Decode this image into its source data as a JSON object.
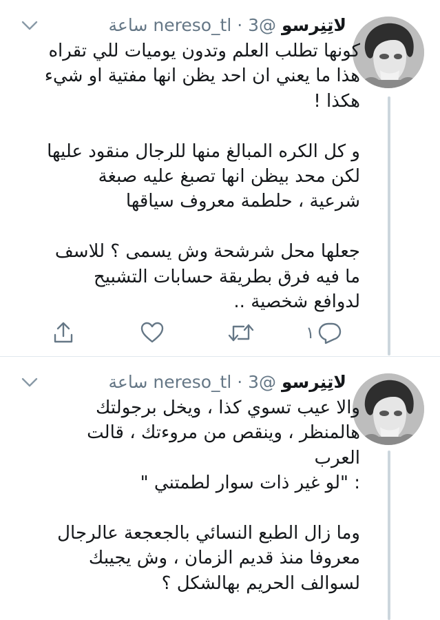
{
  "tweets": [
    {
      "author_name": "لاتِنِرسو",
      "handle": "@nereso_tl",
      "separator": " · ",
      "time": "3 ساعة",
      "avatar_icon": "avatar-photo-icon",
      "menu_icon": "chevron-down-icon",
      "lines": [
        "كونها تطلب العلم وتدون يوميات للي تقراه",
        "هذا ما يعني ان احد يظن انها مفتية او شيء",
        "هكذا !",
        "",
        "و كل الكره المبالغ منها للرجال منقود عليها",
        "لكن محد بيظن انها تصبغ عليه صبغة",
        "شرعية ، حلطمة معروف سياقها",
        "",
        "جعلها محل شرشحة وش يسمى ؟ للاسف",
        "ما فيه فرق بطريقة حسابات التشبيح",
        "لدوافع شخصية .."
      ],
      "actions": {
        "reply_count": "١",
        "reply_icon": "reply-icon",
        "retweet_icon": "retweet-icon",
        "like_icon": "heart-icon",
        "share_icon": "share-icon"
      }
    },
    {
      "author_name": "لاتِنِرسو",
      "handle": "@nereso_tl",
      "separator": " · ",
      "time": "3 ساعة",
      "avatar_icon": "avatar-photo-icon",
      "menu_icon": "chevron-down-icon",
      "lines": [
        "والا عيب تسوي كذا ، ويخل برجولتك",
        "هالمنظر ، وينقص من مروءتك ، قالت",
        "العرب",
        ": \"لو غير ذات سوار لطمتني \"",
        "",
        "وما زال الطبع النسائي بالجعجعة عالرجال",
        "معروفا منذ قديم الزمان ، وش يجيبك",
        "لسوالف الحريم بهالشكل ؟"
      ]
    }
  ],
  "colors": {
    "text": "#14171a",
    "meta": "#657786",
    "icon": "#657786",
    "thread_line": "#ccd6dd",
    "divider": "#e1e8ed"
  }
}
